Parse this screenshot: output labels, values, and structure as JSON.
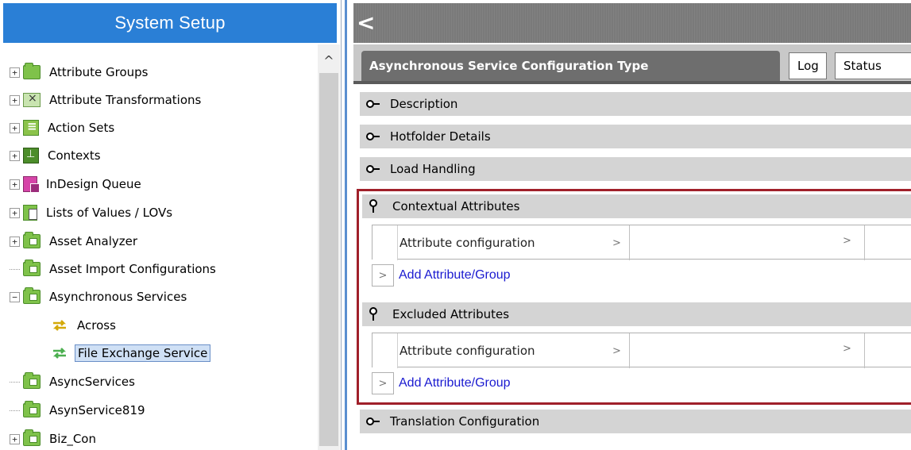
{
  "left": {
    "title": "System Setup",
    "tree": [
      {
        "label": "Attribute Groups",
        "expander": "+",
        "icon": "folder-icon"
      },
      {
        "label": "Attribute Transformations",
        "expander": "+",
        "icon": "transform-icon"
      },
      {
        "label": "Action Sets",
        "expander": "+",
        "icon": "action-set-icon"
      },
      {
        "label": "Contexts",
        "expander": "+",
        "icon": "contexts-icon"
      },
      {
        "label": "InDesign Queue",
        "expander": "+",
        "icon": "indesign-queue-icon"
      },
      {
        "label": "Lists of Values / LOVs",
        "expander": "+",
        "icon": "lov-icon"
      },
      {
        "label": "Asset Analyzer",
        "expander": "+",
        "icon": "folder-icon"
      },
      {
        "label": "Asset Import Configurations",
        "expander": "",
        "icon": "folder-icon"
      },
      {
        "label": "Asynchronous Services",
        "expander": "−",
        "icon": "folder-icon"
      },
      {
        "label": "Across",
        "expander": "",
        "icon": "exchange-arrows-icon"
      },
      {
        "label": "File Exchange Service",
        "expander": "",
        "icon": "exchange-arrows-icon"
      },
      {
        "label": "AsyncServices",
        "expander": "",
        "icon": "folder-icon"
      },
      {
        "label": "AsynService819",
        "expander": "",
        "icon": "folder-icon"
      },
      {
        "label": "Biz_Con",
        "expander": "+",
        "icon": "folder-icon"
      }
    ],
    "scroll_up": "^"
  },
  "right": {
    "back": "<",
    "tabs": {
      "active": "Asynchronous Service Configuration Type",
      "log": "Log",
      "status": "Status"
    },
    "sections": {
      "description": "Description",
      "hotfolder": "Hotfolder Details",
      "load_handling": "Load Handling",
      "contextual": "Contextual Attributes",
      "excluded": "Excluded Attributes",
      "translation": "Translation Configuration"
    },
    "attr_config_label": "Attribute configuration",
    "chevron": ">",
    "add_link": "Add Attribute/Group",
    "colors": {
      "header_blue": "#2a7fd6",
      "highlight_border": "#a0202a",
      "link": "#1a1ad0"
    }
  }
}
